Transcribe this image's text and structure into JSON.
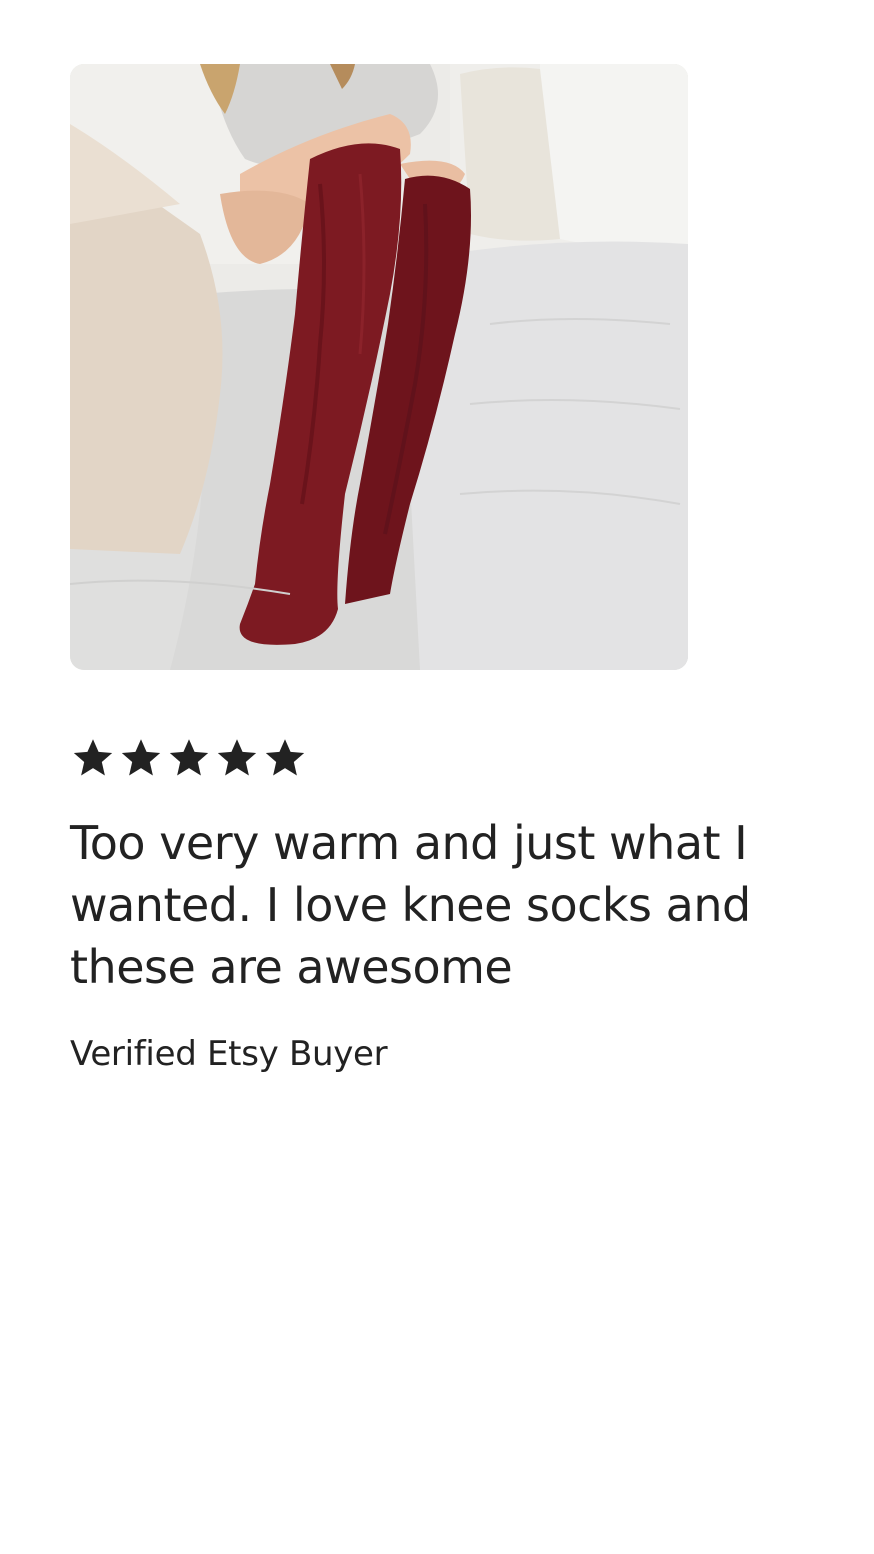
{
  "review": {
    "photo_icon": "product-photo-burgundy-knee-socks",
    "rating": 5,
    "rating_max": 5,
    "star_color": "#222222",
    "text": "Too very warm and just what I wanted. I love knee socks and these are awesome",
    "reviewer": "Verified Etsy Buyer"
  }
}
